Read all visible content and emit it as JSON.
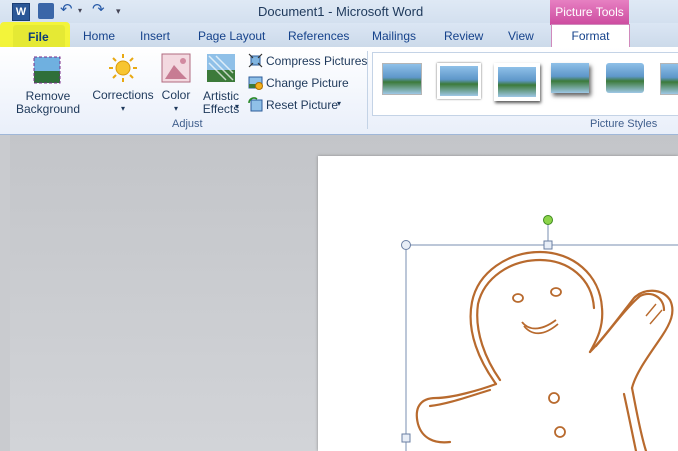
{
  "window": {
    "title": "Document1 - Microsoft Word",
    "qat_icons": [
      "word-icon",
      "save-icon",
      "undo-icon",
      "redo-icon",
      "customize-icon"
    ]
  },
  "tabs": {
    "file": "File",
    "items": [
      "Home",
      "Insert",
      "Page Layout",
      "References",
      "Mailings",
      "Review",
      "View"
    ],
    "context_header": "Picture Tools",
    "format": "Format"
  },
  "ribbon": {
    "adjust": {
      "remove_background": [
        "Remove",
        "Background"
      ],
      "corrections": "Corrections",
      "color": "Color",
      "artistic_effects": [
        "Artistic",
        "Effects"
      ],
      "compress": "Compress Pictures",
      "change": "Change Picture",
      "reset": "Reset Picture",
      "label": "Adjust"
    },
    "picture_styles": {
      "label": "Picture Styles"
    }
  },
  "colors": {
    "highlight": "#f5f52a",
    "picture_tools": "#cc4b9f",
    "file_tab": "#2c5ea4",
    "gingerbread": "#b86a2e"
  }
}
